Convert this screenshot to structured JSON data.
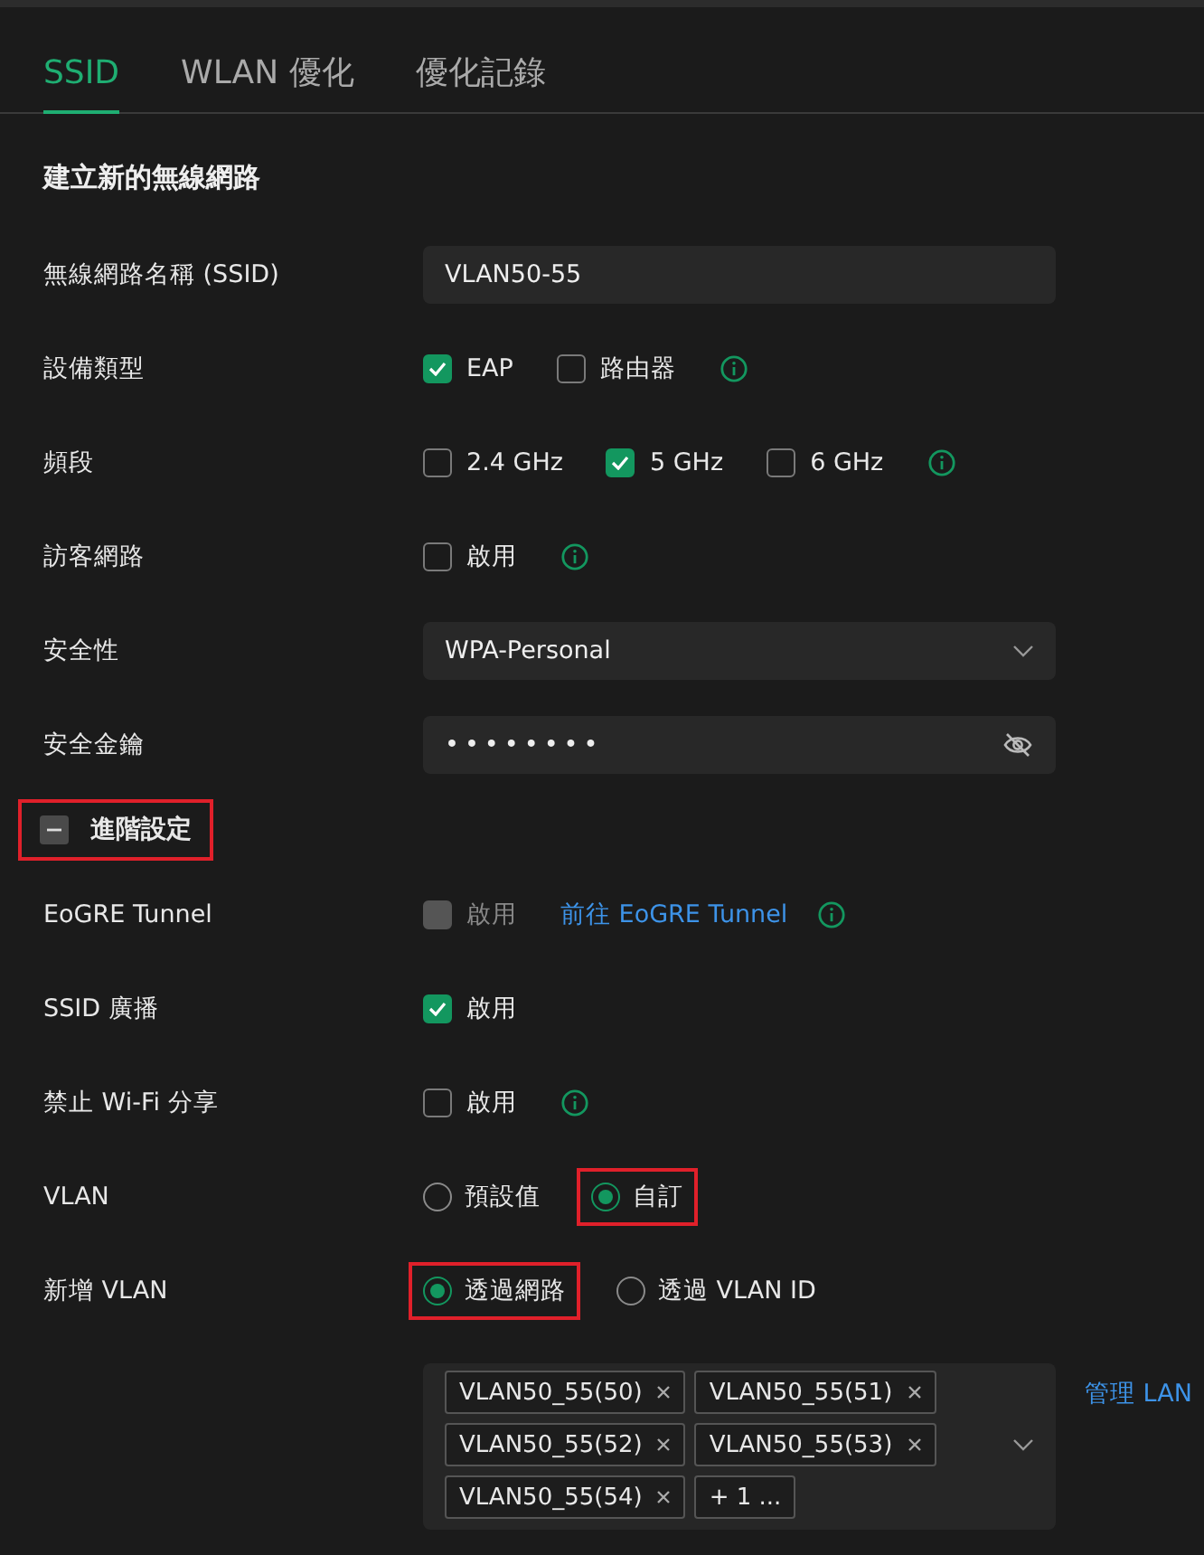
{
  "tabs": [
    {
      "label": "SSID",
      "selected": true
    },
    {
      "label": "WLAN 優化",
      "selected": false
    },
    {
      "label": "優化記錄",
      "selected": false
    }
  ],
  "section_title": "建立新的無線網路",
  "rows": [
    {
      "kind": "text",
      "label": "無線網路名稱 (SSID)",
      "value": "VLAN50-55"
    },
    {
      "kind": "checks",
      "label": "設備類型",
      "info": true,
      "options": [
        {
          "label": "EAP",
          "checked": true,
          "disabled": false
        },
        {
          "label": "路由器",
          "checked": false,
          "disabled": false
        }
      ]
    },
    {
      "kind": "checks",
      "label": "頻段",
      "info": true,
      "options": [
        {
          "label": "2.4 GHz",
          "checked": false,
          "disabled": false
        },
        {
          "label": "5 GHz",
          "checked": true,
          "disabled": false
        },
        {
          "label": "6 GHz",
          "checked": false,
          "disabled": false
        }
      ]
    },
    {
      "kind": "checks",
      "label": "訪客網路",
      "info": true,
      "options": [
        {
          "label": "啟用",
          "checked": false,
          "disabled": false
        }
      ]
    },
    {
      "kind": "select",
      "label": "安全性",
      "value": "WPA-Personal"
    },
    {
      "kind": "password",
      "label": "安全金鑰",
      "value": "••••••••"
    },
    {
      "kind": "section",
      "label": "進階設定",
      "expanded": true,
      "highlighted": true
    },
    {
      "kind": "checks",
      "label": "EoGRE Tunnel",
      "info": true,
      "link": "前往 EoGRE Tunnel",
      "options": [
        {
          "label": "啟用",
          "checked": false,
          "disabled": true
        }
      ]
    },
    {
      "kind": "checks",
      "label": "SSID 廣播",
      "info": false,
      "options": [
        {
          "label": "啟用",
          "checked": true,
          "disabled": false
        }
      ]
    },
    {
      "kind": "checks",
      "label": "禁止 Wi-Fi 分享",
      "info": true,
      "options": [
        {
          "label": "啟用",
          "checked": false,
          "disabled": false
        }
      ]
    },
    {
      "kind": "radios",
      "label": "VLAN",
      "options": [
        {
          "label": "預設值",
          "selected": false,
          "highlighted": false
        },
        {
          "label": "自訂",
          "selected": true,
          "highlighted": true
        }
      ]
    },
    {
      "kind": "radios",
      "label": "新增 VLAN",
      "options": [
        {
          "label": "透過網路",
          "selected": true,
          "highlighted": true
        },
        {
          "label": "透過 VLAN ID",
          "selected": false,
          "highlighted": false
        }
      ]
    },
    {
      "kind": "tags",
      "tags": [
        "VLAN50_55(50)",
        "VLAN50_55(51)",
        "VLAN50_55(52)",
        "VLAN50_55(53)",
        "VLAN50_55(54)"
      ],
      "more": "+ 1 ...",
      "link": "管理 LAN"
    }
  ]
}
